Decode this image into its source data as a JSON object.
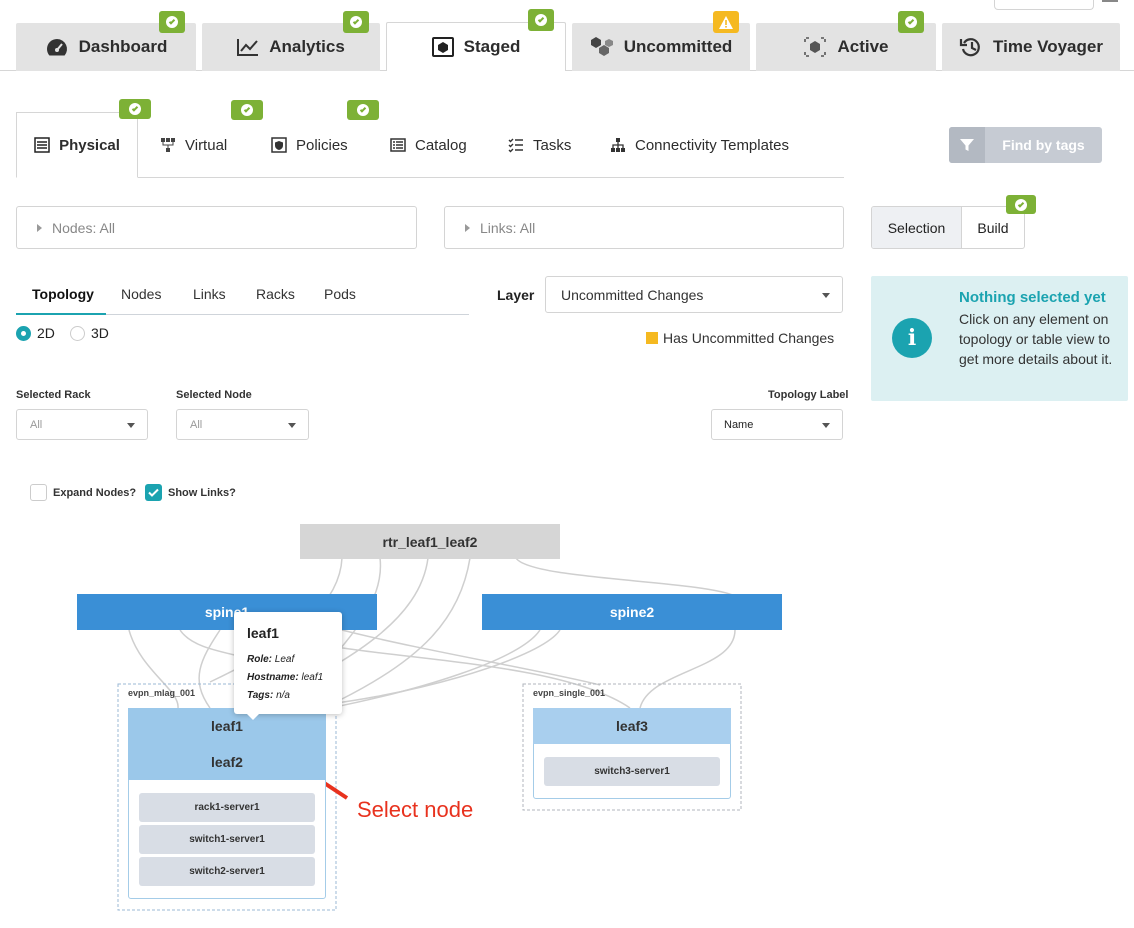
{
  "top_tabs": [
    {
      "label": "Dashboard",
      "icon": "dashboard-gauge-icon",
      "status": "ok"
    },
    {
      "label": "Analytics",
      "icon": "analytics-chart-icon",
      "status": "ok"
    },
    {
      "label": "Staged",
      "icon": "staged-cube-icon",
      "status": "ok",
      "active": true
    },
    {
      "label": "Uncommitted",
      "icon": "uncommitted-cubes-icon",
      "status": "warning"
    },
    {
      "label": "Active",
      "icon": "active-cube-icon",
      "status": "ok"
    },
    {
      "label": "Time Voyager",
      "icon": "history-clock-icon"
    }
  ],
  "sub_tabs": [
    {
      "label": "Physical",
      "icon": "physical-rack-icon",
      "status": "ok",
      "active": true
    },
    {
      "label": "Virtual",
      "icon": "virtual-network-icon",
      "status": "ok"
    },
    {
      "label": "Policies",
      "icon": "policies-shield-icon",
      "status": "ok"
    },
    {
      "label": "Catalog",
      "icon": "catalog-list-icon"
    },
    {
      "label": "Tasks",
      "icon": "tasks-checklist-icon"
    },
    {
      "label": "Connectivity Templates",
      "icon": "connectivity-tree-icon"
    }
  ],
  "find_by_tags": "Find by tags",
  "filters": {
    "nodes": "Nodes: All",
    "links": "Links: All"
  },
  "mode_toggle": {
    "selection": "Selection",
    "build": "Build"
  },
  "info_panel": {
    "title": "Nothing selected yet",
    "body": "Click on any element on topology or table view to get more details about it."
  },
  "view_tabs": [
    "Topology",
    "Nodes",
    "Links",
    "Racks",
    "Pods"
  ],
  "dimension": {
    "d2": "2D",
    "d3": "3D",
    "selected": "2D"
  },
  "layer": {
    "label": "Layer",
    "value": "Uncommitted Changes",
    "legend": "Has Uncommitted Changes",
    "legend_color": "#f5b921"
  },
  "selected_rack": {
    "label": "Selected Rack",
    "value": "All"
  },
  "selected_node": {
    "label": "Selected Node",
    "value": "All"
  },
  "topology_label": {
    "label": "Topology Label",
    "value": "Name"
  },
  "options": {
    "expand_nodes": "Expand Nodes?",
    "show_links": "Show Links?",
    "expand_checked": false,
    "show_checked": true
  },
  "topology": {
    "router": "rtr_leaf1_leaf2",
    "spine1": "spine1",
    "spine2": "spine2",
    "rack1_name": "evpn_mlag_001",
    "rack2_name": "evpn_single_001",
    "leaf1": "leaf1",
    "leaf2": "leaf2",
    "leaf3": "leaf3",
    "servers_rack1": [
      "rack1-server1",
      "switch1-server1",
      "switch2-server1"
    ],
    "servers_rack2": [
      "switch3-server1"
    ]
  },
  "tooltip": {
    "title": "leaf1",
    "role_key": "Role:",
    "role_val": "Leaf",
    "hostname_key": "Hostname:",
    "hostname_val": "leaf1",
    "tags_key": "Tags:",
    "tags_val": "n/a"
  },
  "annotation": {
    "text": "Select node",
    "color": "#e8321e"
  },
  "colors": {
    "ok": "#7db136",
    "warn": "#f5b921",
    "spine": "#3a8fd6",
    "accent": "#1ba3b0",
    "info_bg": "#dcf0f2"
  }
}
